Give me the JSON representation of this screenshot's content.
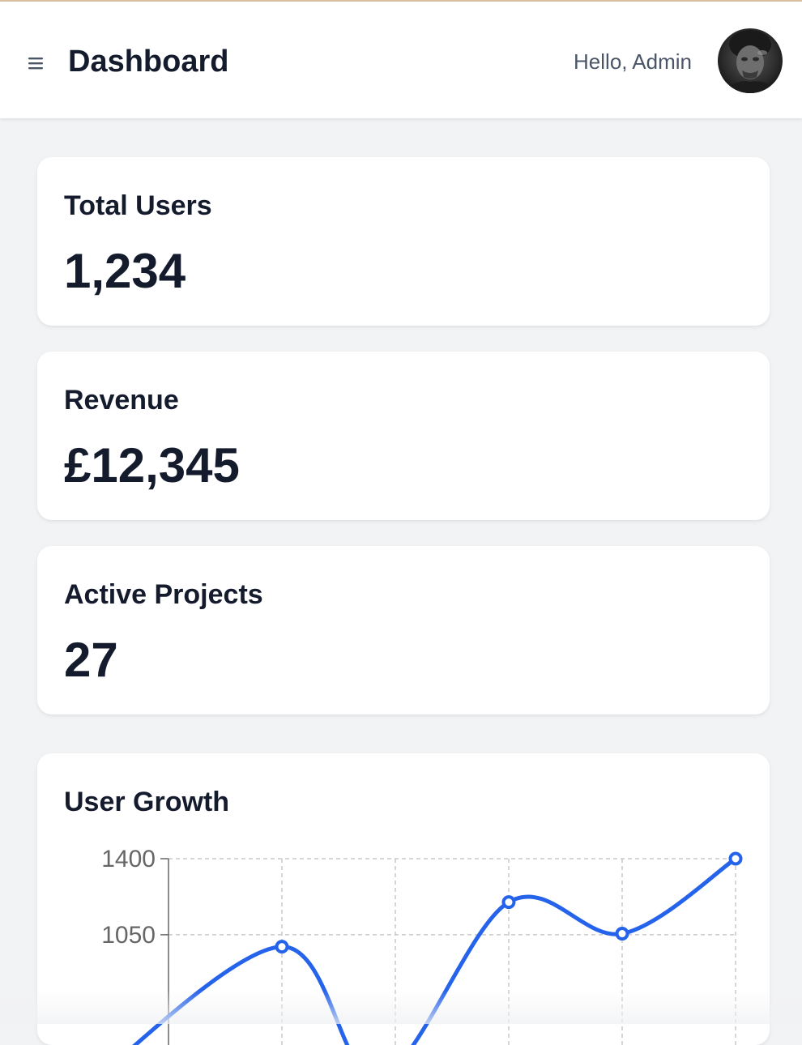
{
  "header": {
    "title": "Dashboard",
    "greeting": "Hello, Admin",
    "menu_icon": "hamburger-menu-icon",
    "avatar_icon": "user-avatar"
  },
  "cards": [
    {
      "label": "Total Users",
      "value": "1,234"
    },
    {
      "label": "Revenue",
      "value": "£12,345"
    },
    {
      "label": "Active Projects",
      "value": "27"
    }
  ],
  "colors": {
    "accent": "#2563eb",
    "background": "#f2f3f5",
    "card": "#ffffff",
    "text": "#141b2d",
    "muted_text": "#4a5568",
    "grid": "#c9c9c9",
    "axis_text": "#666666"
  },
  "chart": {
    "title": "User Growth"
  },
  "chart_data": {
    "type": "line",
    "title": "User Growth",
    "xlabel": "",
    "ylabel": "",
    "y_ticks": [
      1050,
      1400
    ],
    "ylim_visible": [
      700,
      1400
    ],
    "x_categories_count": 6,
    "series": [
      {
        "values": [
          null,
          995,
          null,
          1200,
          1055,
          1400
        ]
      }
    ],
    "grid": true,
    "smooth": true
  }
}
